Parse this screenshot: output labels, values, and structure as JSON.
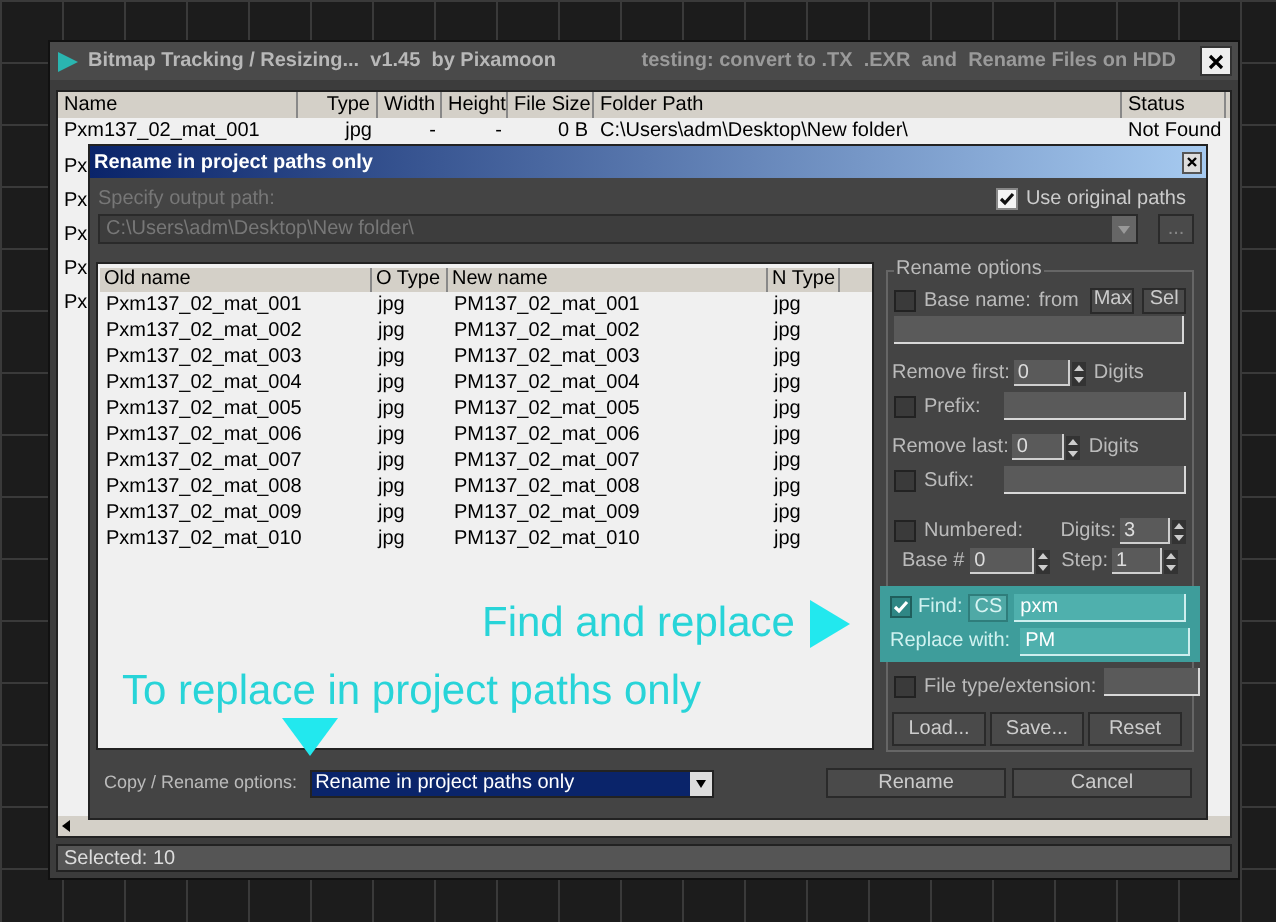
{
  "window": {
    "title": "Bitmap Tracking / Resizing...  v1.45  by Pixamoon",
    "subtitle": "testing: convert to .TX  .EXR  and  Rename Files on HDD"
  },
  "table": {
    "columns": [
      "Name",
      "Type",
      "Width",
      "Height",
      "File Size",
      "Folder Path",
      "Status"
    ],
    "rows": [
      {
        "cells": [
          "Pxm137_02_mat_001",
          "jpg",
          "-",
          "-",
          "0 B",
          "C:\\Users\\adm\\Desktop\\New folder\\",
          "Not Found"
        ]
      }
    ],
    "hidden_rows": [
      "Px",
      "Px",
      "Px",
      "Px",
      "Px"
    ]
  },
  "dialog": {
    "title": "Rename in project paths only",
    "output_path": {
      "label": "Specify output path:",
      "value": "C:\\Users\\adm\\Desktop\\New folder\\",
      "disabled": true,
      "browse_button": "..."
    },
    "use_original_paths": {
      "label": "Use original paths",
      "checked": true
    },
    "list": {
      "columns": [
        "Old name",
        "O Type",
        "New name",
        "N Type"
      ],
      "rows": [
        {
          "cells": [
            "Pxm137_02_mat_001",
            "jpg",
            "PM137_02_mat_001",
            "jpg"
          ]
        },
        {
          "cells": [
            "Pxm137_02_mat_002",
            "jpg",
            "PM137_02_mat_002",
            "jpg"
          ]
        },
        {
          "cells": [
            "Pxm137_02_mat_003",
            "jpg",
            "PM137_02_mat_003",
            "jpg"
          ]
        },
        {
          "cells": [
            "Pxm137_02_mat_004",
            "jpg",
            "PM137_02_mat_004",
            "jpg"
          ]
        },
        {
          "cells": [
            "Pxm137_02_mat_005",
            "jpg",
            "PM137_02_mat_005",
            "jpg"
          ]
        },
        {
          "cells": [
            "Pxm137_02_mat_006",
            "jpg",
            "PM137_02_mat_006",
            "jpg"
          ]
        },
        {
          "cells": [
            "Pxm137_02_mat_007",
            "jpg",
            "PM137_02_mat_007",
            "jpg"
          ]
        },
        {
          "cells": [
            "Pxm137_02_mat_008",
            "jpg",
            "PM137_02_mat_008",
            "jpg"
          ]
        },
        {
          "cells": [
            "Pxm137_02_mat_009",
            "jpg",
            "PM137_02_mat_009",
            "jpg"
          ]
        },
        {
          "cells": [
            "Pxm137_02_mat_010",
            "jpg",
            "PM137_02_mat_010",
            "jpg"
          ]
        }
      ]
    },
    "rename_options": {
      "title": "Rename options",
      "base_name": {
        "label": "Base name:",
        "checked": false,
        "from_label": "from",
        "max_button": "Max",
        "sel_button": "Sel"
      },
      "remove_first": {
        "label": "Remove first:",
        "value": "0",
        "unit": "Digits"
      },
      "prefix": {
        "label": "Prefix:",
        "checked": false
      },
      "remove_last": {
        "label": "Remove last:",
        "value": "0",
        "unit": "Digits"
      },
      "sufix": {
        "label": "Sufix:",
        "checked": false
      },
      "numbered": {
        "label": "Numbered:",
        "checked": false
      },
      "digits": {
        "label": "Digits:",
        "value": "3"
      },
      "base": {
        "label": "Base #",
        "value": "0"
      },
      "step": {
        "label": "Step:",
        "value": "1"
      },
      "find": {
        "label": "Find:",
        "checked": true,
        "cs_button": "CS",
        "value": "pxm"
      },
      "replace": {
        "label": "Replace with:",
        "value": "PM"
      },
      "file_type": {
        "label": "File type/extension:",
        "checked": false
      },
      "buttons": [
        "Load...",
        "Save...",
        "Reset"
      ]
    },
    "copy_rename": {
      "label": "Copy / Rename options:",
      "value": "Rename in project paths only"
    },
    "buttons": [
      "Rename",
      "Cancel"
    ]
  },
  "annotations": [
    {
      "text": "Find and replace",
      "kind": "arrow-right"
    },
    {
      "text": "To replace in project paths only",
      "kind": "arrow-down"
    }
  ],
  "status_bar": "Selected: 10"
}
